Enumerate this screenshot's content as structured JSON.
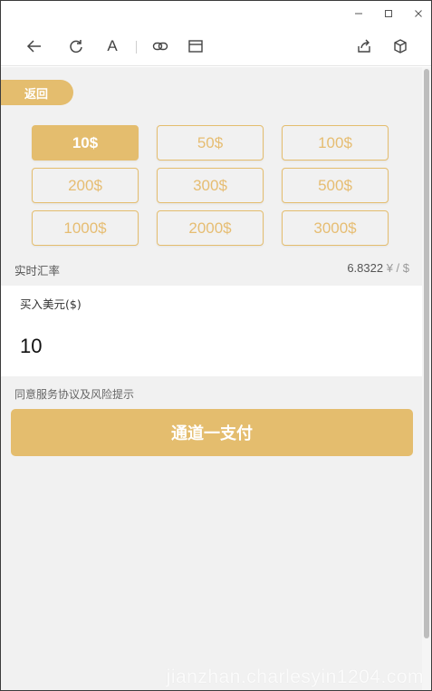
{
  "window_controls": {
    "minimize": "minimize-icon",
    "maximize": "maximize-icon",
    "close": "close-icon"
  },
  "toolbar": {
    "icons": [
      "back-arrow-icon",
      "refresh-icon",
      "font-icon",
      "link-icon",
      "window-icon",
      "share-icon",
      "cube-icon"
    ],
    "font_glyph": "A"
  },
  "page": {
    "back_label": "返回",
    "amounts": [
      "10$",
      "50$",
      "100$",
      "200$",
      "300$",
      "500$",
      "1000$",
      "2000$",
      "3000$"
    ],
    "selected_amount": "10$",
    "rate_label": "实时汇率",
    "rate_value": "6.8322",
    "rate_unit": "¥ / $",
    "buy_title": "买入美元($)",
    "buy_amount": "10",
    "agreement": "同意服务协议及风险提示",
    "pay_label": "通道一支付"
  },
  "colors": {
    "accent": "#e4bd6e",
    "background": "#f1f1f1",
    "panel": "#ffffff"
  },
  "watermark": "jianzhan.charlesyin1204.com"
}
